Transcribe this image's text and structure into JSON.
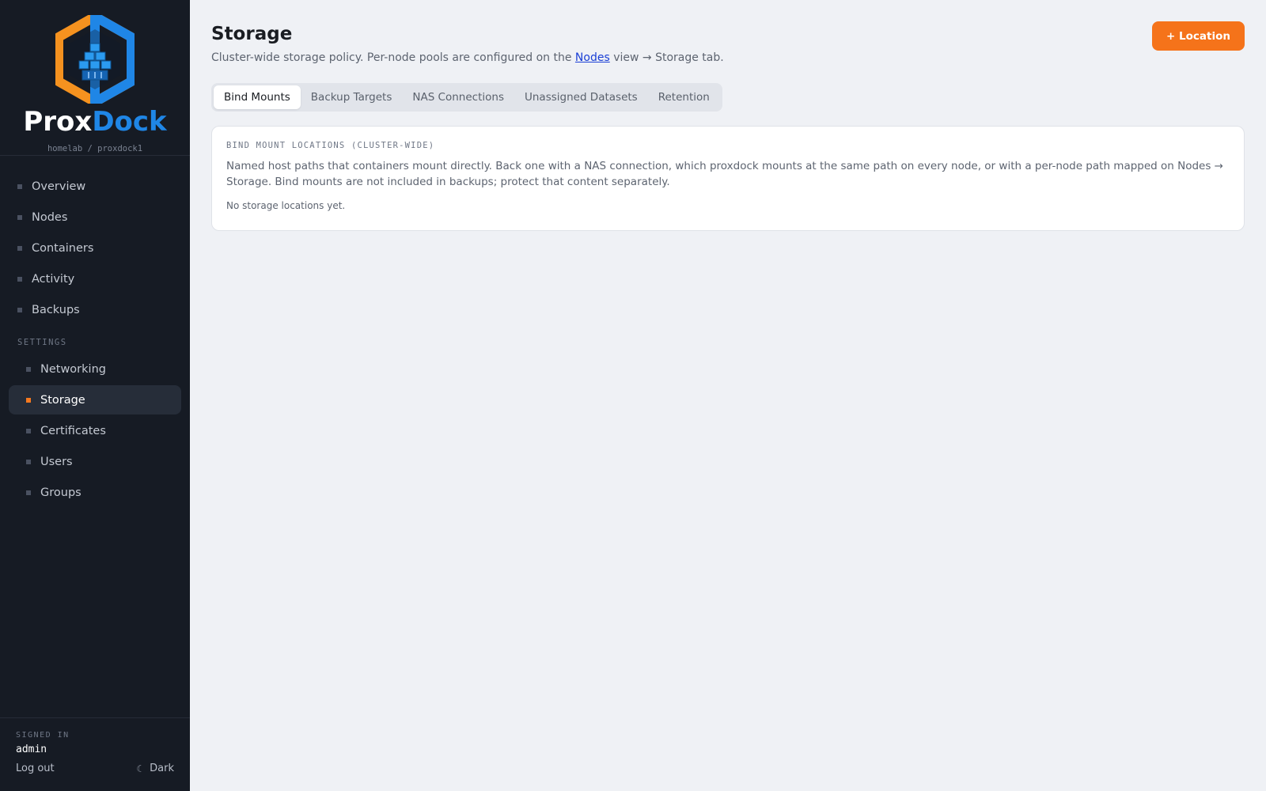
{
  "brand": {
    "word_primary": "Prox",
    "word_accent": "Dock",
    "subtitle": "homelab / proxdock1",
    "colors": {
      "orange": "#f5791f",
      "blue": "#1f86e6"
    }
  },
  "nav": {
    "items": [
      {
        "label": "Overview"
      },
      {
        "label": "Nodes"
      },
      {
        "label": "Containers"
      },
      {
        "label": "Activity"
      },
      {
        "label": "Backups"
      }
    ],
    "settings_label": "SETTINGS",
    "settings_items": [
      {
        "label": "Networking"
      },
      {
        "label": "Storage",
        "active": true
      },
      {
        "label": "Certificates"
      },
      {
        "label": "Users"
      },
      {
        "label": "Groups"
      }
    ]
  },
  "footer": {
    "signed_in_label": "SIGNED IN",
    "user": "admin",
    "logout_label": "Log out",
    "theme_label": "Dark",
    "theme_icon": "moon-icon"
  },
  "page": {
    "title": "Storage",
    "subtitle_before": "Cluster-wide storage policy. Per-node pools are configured on the ",
    "subtitle_link": "Nodes",
    "subtitle_after": " view → Storage tab.",
    "add_button": "+ Location",
    "accent": "#f5731a"
  },
  "tabs": [
    {
      "label": "Bind Mounts",
      "active": true
    },
    {
      "label": "Backup Targets"
    },
    {
      "label": "NAS Connections"
    },
    {
      "label": "Unassigned Datasets"
    },
    {
      "label": "Retention"
    }
  ],
  "card": {
    "label": "BIND MOUNT LOCATIONS (CLUSTER-WIDE)",
    "description": "Named host paths that containers mount directly. Back one with a NAS connection, which proxdock mounts at the same path on every node, or with a per-node path mapped on Nodes → Storage. Bind mounts are not included in backups; protect that content separately.",
    "empty_text": "No storage locations yet."
  }
}
